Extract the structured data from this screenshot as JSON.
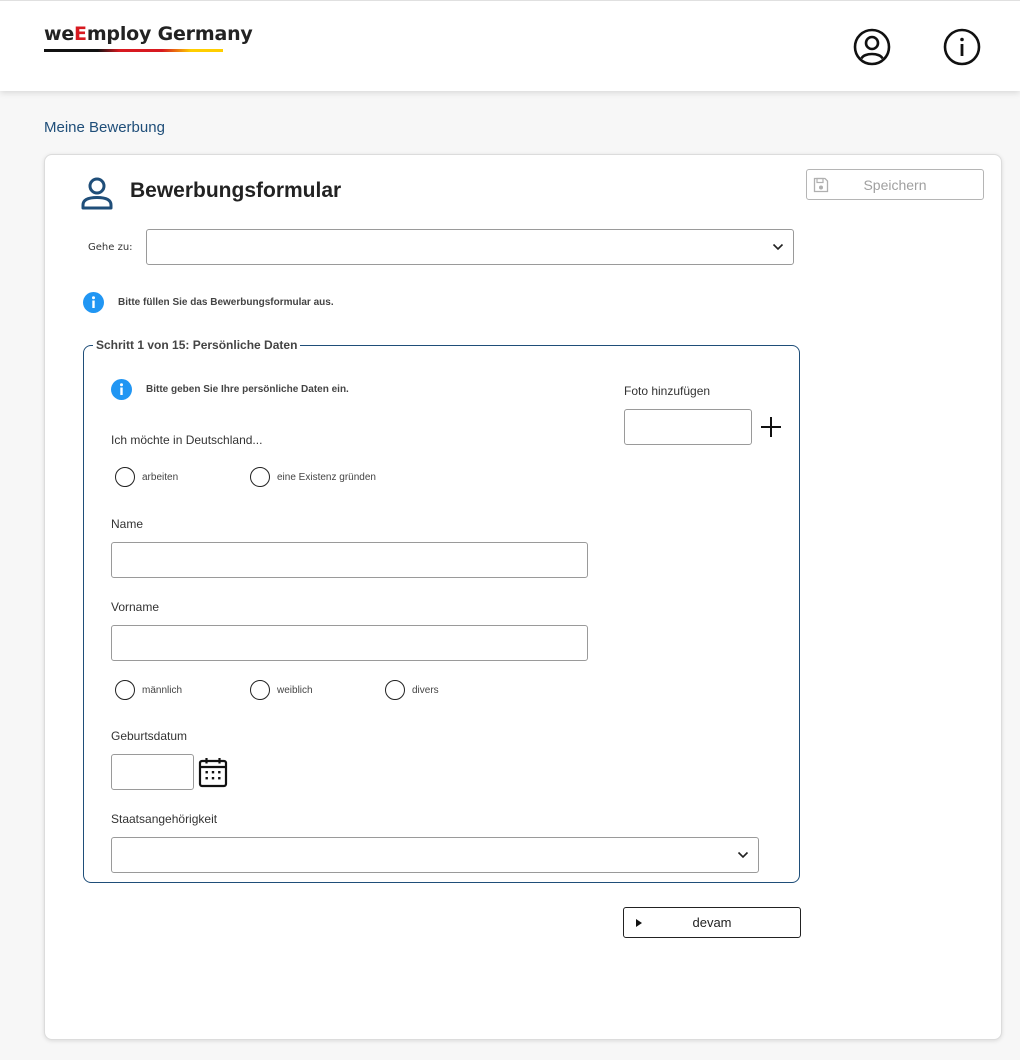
{
  "header": {
    "logo_prefix": "we",
    "logo_e": "E",
    "logo_rest": "mploy Germany"
  },
  "breadcrumb": "Meine Bewerbung",
  "form": {
    "title": "Bewerbungsformular",
    "save_label": "Speichern",
    "goto_label": "Gehe zu:",
    "goto_value": "",
    "info_text": "Bitte füllen Sie das Bewerbungsformular aus."
  },
  "step": {
    "legend": "Schritt 1 von 15: Persönliche Daten",
    "info_text": "Bitte geben Sie Ihre persönliche Daten ein.",
    "intent_label": "Ich möchte in Deutschland...",
    "intent_options": [
      "arbeiten",
      "eine Existenz gründen"
    ],
    "photo_label": "Foto hinzufügen",
    "name_label": "Name",
    "name_value": "",
    "vorname_label": "Vorname",
    "vorname_value": "",
    "gender_options": [
      "männlich",
      "weiblich",
      "divers"
    ],
    "birthdate_label": "Geburtsdatum",
    "birthdate_value": "",
    "nationality_label": "Staatsangehörigkeit",
    "nationality_value": ""
  },
  "next_label": "devam",
  "colors": {
    "accent": "#1f4e79",
    "info": "#2196f3",
    "logo_red": "#d71920",
    "logo_gold": "#ffce00"
  },
  "icons": {
    "account": "account-circle-icon",
    "info": "info-circle-icon",
    "person": "person-icon",
    "save": "floppy-disk-icon",
    "chevron": "chevron-down-icon",
    "plus": "plus-icon",
    "calendar": "calendar-icon",
    "arrow": "triangle-right-icon"
  }
}
